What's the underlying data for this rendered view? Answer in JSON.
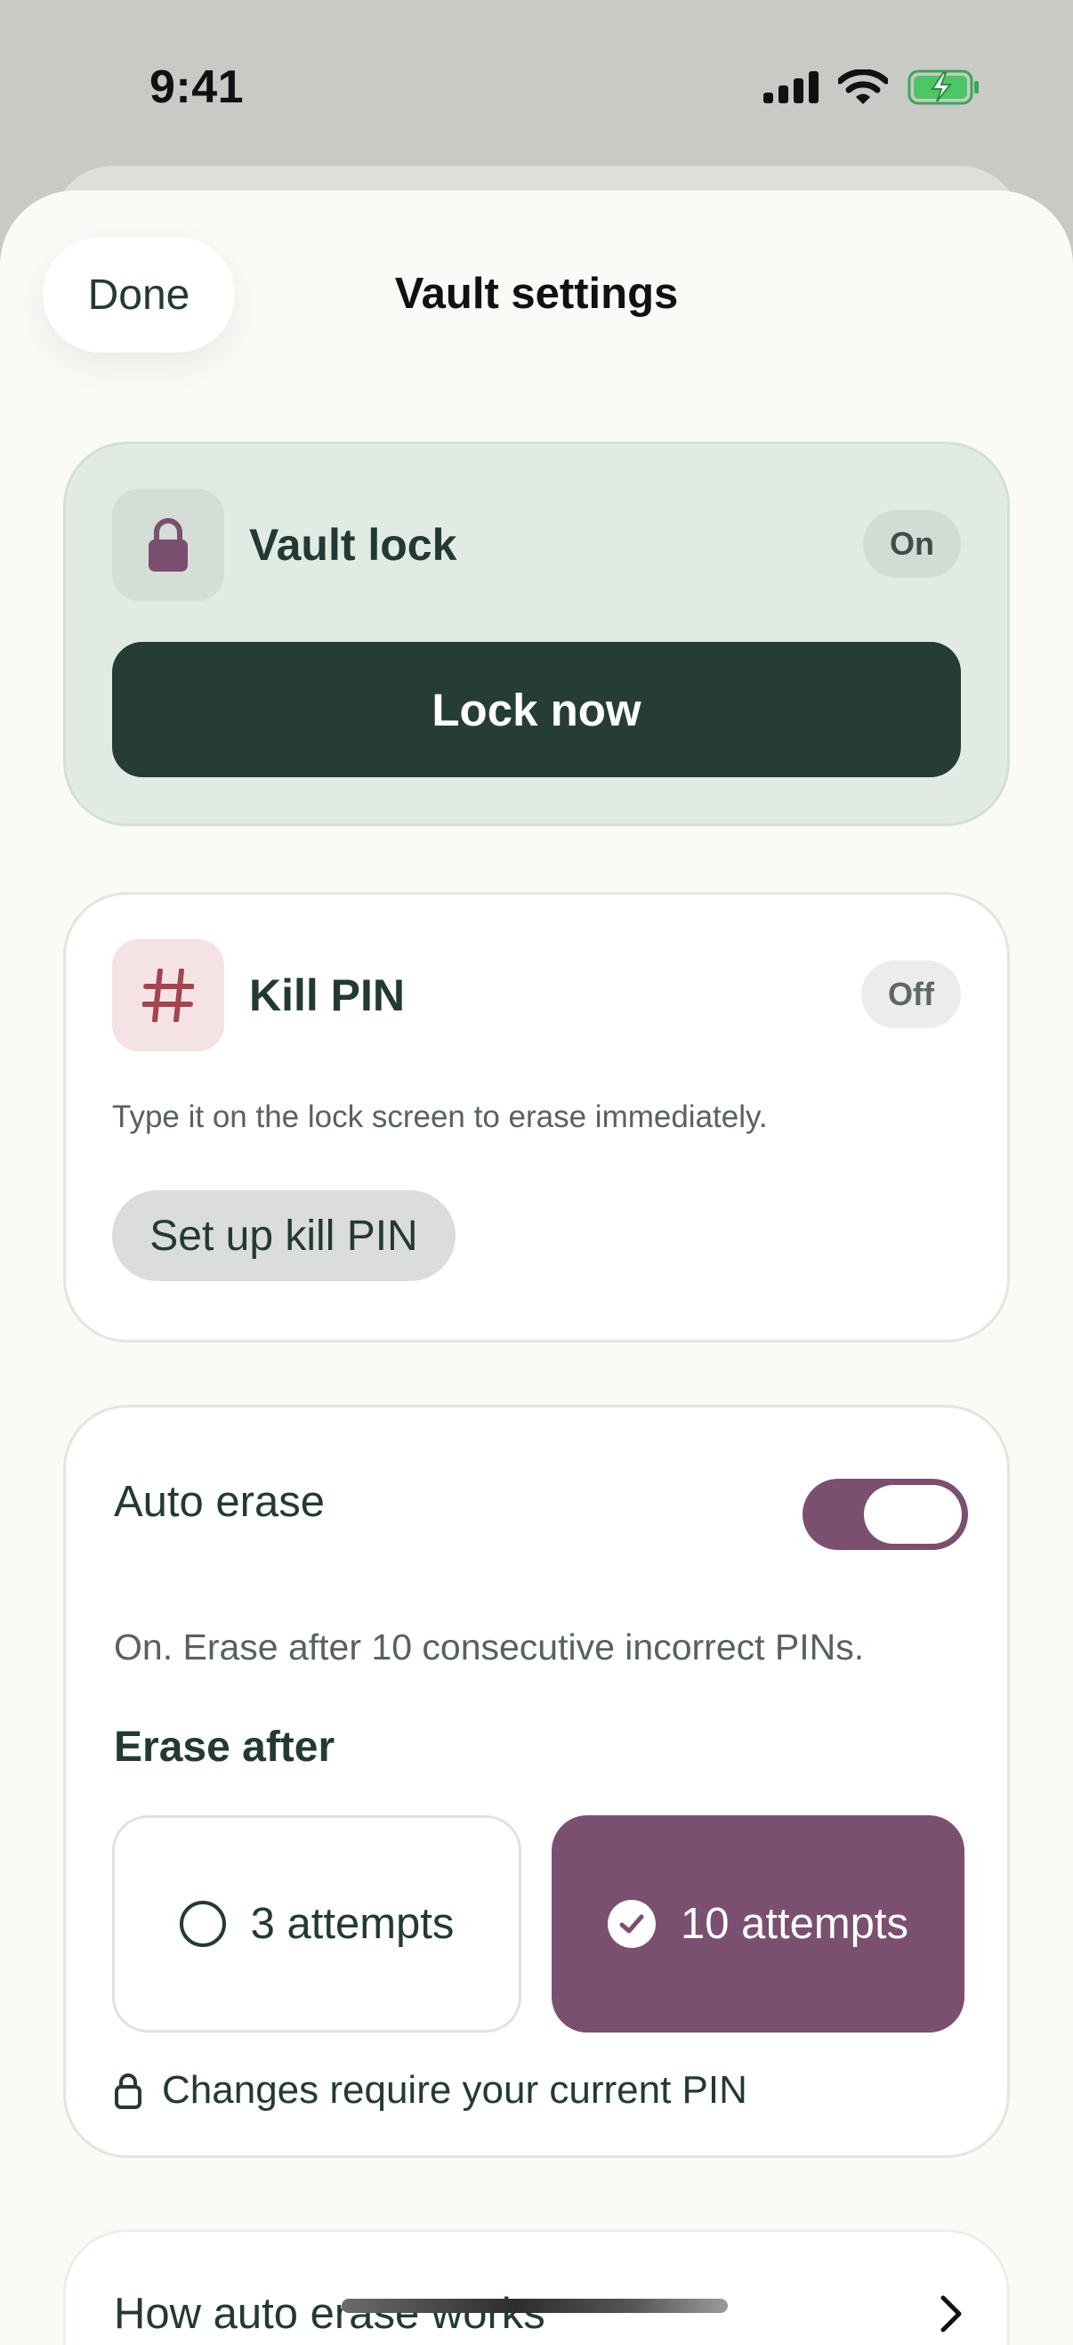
{
  "status_bar": {
    "time": "9:41",
    "icons": [
      "cellular-signal-icon",
      "wifi-icon",
      "battery-charging-icon"
    ]
  },
  "header": {
    "done_label": "Done",
    "title": "Vault settings"
  },
  "vault_lock": {
    "icon": "lock-icon",
    "title": "Vault lock",
    "status": "On",
    "button_label": "Lock now"
  },
  "kill_pin": {
    "icon": "hash-icon",
    "title": "Kill PIN",
    "status": "Off",
    "description": "Type it on the lock screen to erase immediately.",
    "button_label": "Set up kill PIN"
  },
  "auto_erase": {
    "label": "Auto erase",
    "enabled": true,
    "status_text": "On. Erase after 10 consecutive incorrect PINs.",
    "erase_after_label": "Erase after",
    "options": [
      {
        "label": "3 attempts",
        "selected": false
      },
      {
        "label": "10 attempts",
        "selected": true
      }
    ],
    "note": "Changes require your current PIN"
  },
  "how_it_works": {
    "label": "How auto erase works"
  },
  "colors": {
    "accent": "#7b4f6f",
    "primary_dark": "#263d36",
    "lock_card_bg": "#e1ebe3",
    "sheet_bg": "#fafaf6"
  }
}
